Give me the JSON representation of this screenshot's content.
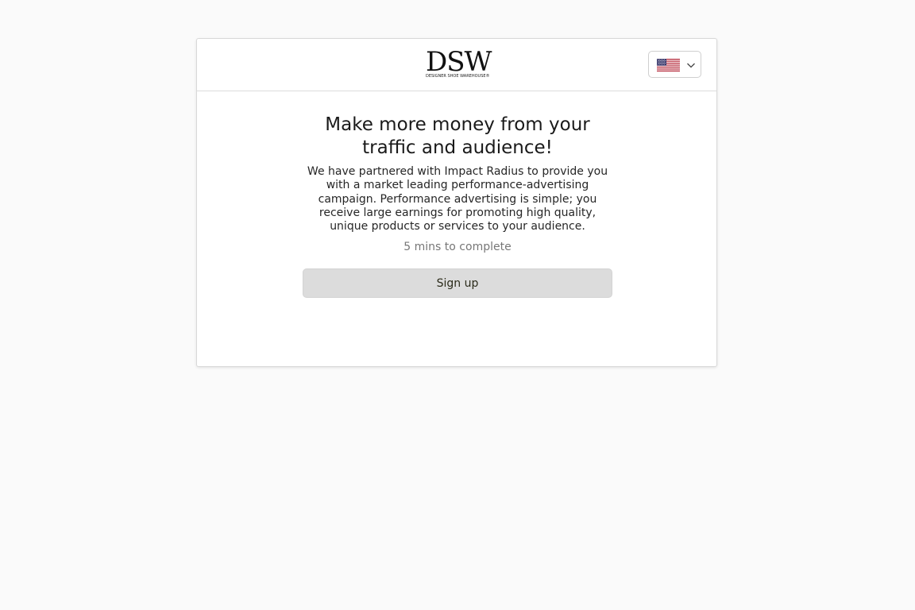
{
  "brand": {
    "name": "DSW",
    "tagline": "DESIGNER SHOE WAREHOUSE®"
  },
  "language_selector": {
    "icon": "us-flag-icon",
    "chevron_icon": "chevron-down-icon"
  },
  "main": {
    "title": "Make more money from your traffic and audience!",
    "description": "We have partnered with Impact Radius to provide you with a market leading performance-advertising campaign. Performance advertising is simple; you receive large earnings for promoting high quality, unique products or services to your audience.",
    "duration": "5 mins to complete",
    "signup_label": "Sign up"
  },
  "colors": {
    "page_background": "#fafafa",
    "card_background": "#ffffff",
    "button_background": "#dcdcdc",
    "flag_red": "#b22234",
    "flag_blue": "#3c3b6e"
  }
}
